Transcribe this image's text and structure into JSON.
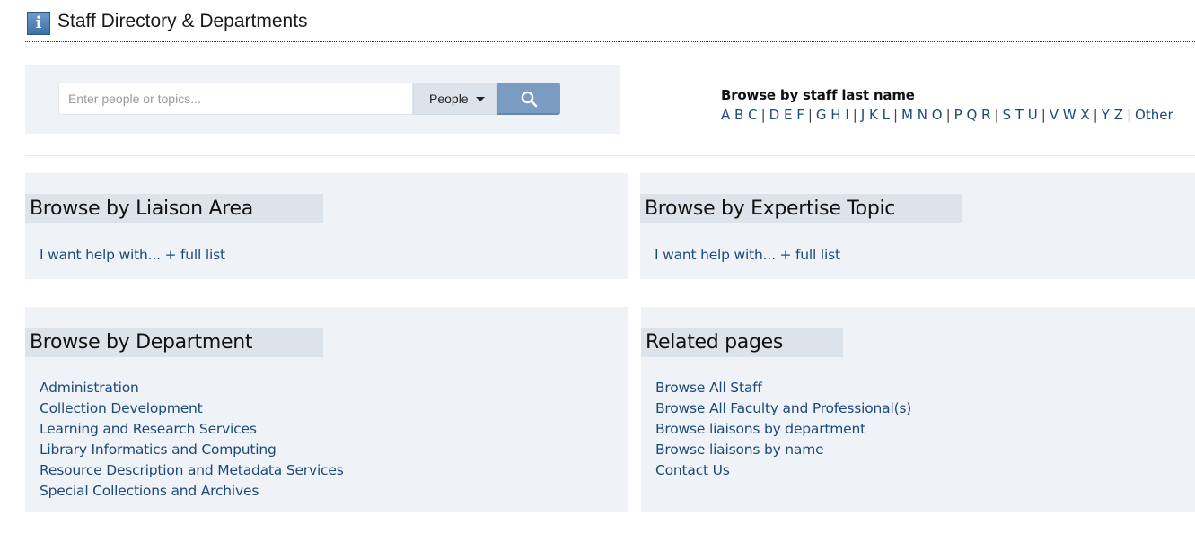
{
  "header": {
    "icon": "info-icon",
    "title": "Staff Directory & Departments"
  },
  "search": {
    "placeholder": "Enter people or topics...",
    "value": "",
    "scope": "People",
    "scope_icon": "chevron-down-icon",
    "button_icon": "search-icon"
  },
  "lastname": {
    "heading": "Browse by staff last name",
    "letters": [
      "A B C",
      "D E F",
      "G H I",
      "J K L",
      "M N O",
      "P Q R",
      "S T U",
      "V W X",
      "Y Z",
      "Other"
    ]
  },
  "liaison": {
    "title": "Browse by Liaison Area",
    "link": "I want help with... + full list"
  },
  "expertise": {
    "title": "Browse by Expertise Topic",
    "link": "I want help with... + full list"
  },
  "department": {
    "title": "Browse by Department",
    "items": [
      "Administration",
      "Collection Development",
      "Learning and Research Services",
      "Library Informatics and Computing",
      "Resource Description and Metadata Services",
      "Special Collections and Archives"
    ]
  },
  "related": {
    "title": "Related pages",
    "items": [
      "Browse All Staff",
      "Browse All Faculty and Professional(s)",
      "Browse liaisons by department",
      "Browse liaisons by name",
      "Contact Us"
    ]
  },
  "colors": {
    "link": "#1c4a7a",
    "panel_bg": "#eff2f6",
    "panel_title_bg": "#dde3eb",
    "search_button": "#7b9cc2"
  }
}
